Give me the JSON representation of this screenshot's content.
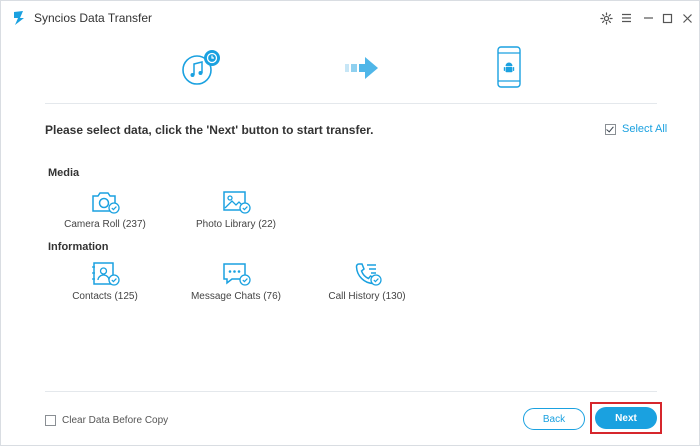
{
  "window": {
    "title": "Syncios Data Transfer",
    "accent_color": "#1aa1e0",
    "highlight_color": "#d6262c"
  },
  "titlebar": {
    "icons": [
      "gear-icon",
      "menu-icon",
      "minimize-icon",
      "maximize-icon",
      "close-icon"
    ]
  },
  "transfer": {
    "source_icon": "music-device-icon",
    "direction_icon": "arrow-right-icon",
    "target_icon": "android-phone-icon"
  },
  "instruction": "Please select data, click the 'Next' button to start transfer.",
  "select_all": {
    "label": "Select All",
    "checked": true
  },
  "sections": [
    {
      "label": "Media",
      "items": [
        {
          "label": "Camera Roll (237)",
          "icon": "camera-icon"
        },
        {
          "label": "Photo Library (22)",
          "icon": "photo-icon"
        }
      ]
    },
    {
      "label": "Information",
      "items": [
        {
          "label": "Contacts (125)",
          "icon": "contacts-icon"
        },
        {
          "label": "Message Chats (76)",
          "icon": "message-icon"
        },
        {
          "label": "Call History (130)",
          "icon": "call-history-icon"
        }
      ]
    }
  ],
  "footer": {
    "clear_data_label": "Clear Data Before Copy",
    "clear_data_checked": false,
    "back_label": "Back",
    "next_label": "Next"
  }
}
